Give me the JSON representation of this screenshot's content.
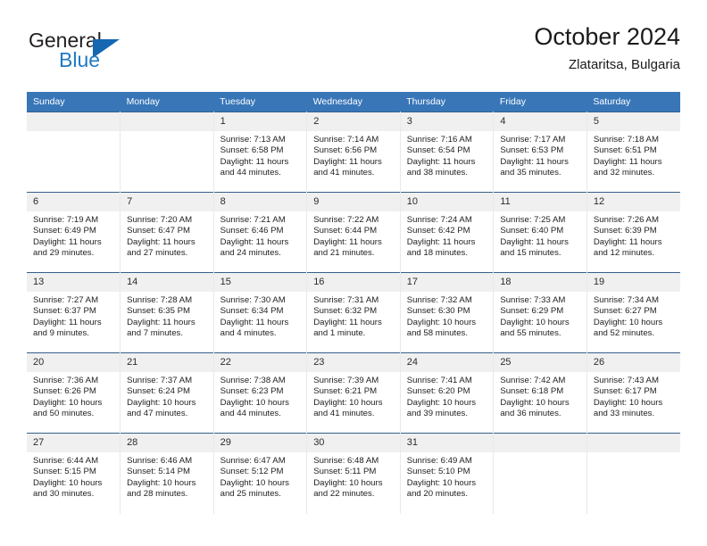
{
  "brand": {
    "name_top": "General",
    "name_bottom": "Blue",
    "accent_color": "#1567b2",
    "blue_text_color": "#1f7ac4"
  },
  "header": {
    "title": "October 2024",
    "subtitle": "Zlataritsa, Bulgaria"
  },
  "calendar": {
    "header_bg": "#3876b8",
    "header_text_color": "#ffffff",
    "daynum_bg": "#f0f0f0",
    "row_rule_color": "#34618c",
    "weekday_headers": [
      "Sunday",
      "Monday",
      "Tuesday",
      "Wednesday",
      "Thursday",
      "Friday",
      "Saturday"
    ],
    "weeks": [
      [
        {
          "date": "",
          "sunrise": "",
          "sunset": "",
          "daylight": "",
          "empty": true
        },
        {
          "date": "",
          "sunrise": "",
          "sunset": "",
          "daylight": "",
          "empty": true
        },
        {
          "date": "1",
          "sunrise": "Sunrise: 7:13 AM",
          "sunset": "Sunset: 6:58 PM",
          "daylight": "Daylight: 11 hours and 44 minutes."
        },
        {
          "date": "2",
          "sunrise": "Sunrise: 7:14 AM",
          "sunset": "Sunset: 6:56 PM",
          "daylight": "Daylight: 11 hours and 41 minutes."
        },
        {
          "date": "3",
          "sunrise": "Sunrise: 7:16 AM",
          "sunset": "Sunset: 6:54 PM",
          "daylight": "Daylight: 11 hours and 38 minutes."
        },
        {
          "date": "4",
          "sunrise": "Sunrise: 7:17 AM",
          "sunset": "Sunset: 6:53 PM",
          "daylight": "Daylight: 11 hours and 35 minutes."
        },
        {
          "date": "5",
          "sunrise": "Sunrise: 7:18 AM",
          "sunset": "Sunset: 6:51 PM",
          "daylight": "Daylight: 11 hours and 32 minutes."
        }
      ],
      [
        {
          "date": "6",
          "sunrise": "Sunrise: 7:19 AM",
          "sunset": "Sunset: 6:49 PM",
          "daylight": "Daylight: 11 hours and 29 minutes."
        },
        {
          "date": "7",
          "sunrise": "Sunrise: 7:20 AM",
          "sunset": "Sunset: 6:47 PM",
          "daylight": "Daylight: 11 hours and 27 minutes."
        },
        {
          "date": "8",
          "sunrise": "Sunrise: 7:21 AM",
          "sunset": "Sunset: 6:46 PM",
          "daylight": "Daylight: 11 hours and 24 minutes."
        },
        {
          "date": "9",
          "sunrise": "Sunrise: 7:22 AM",
          "sunset": "Sunset: 6:44 PM",
          "daylight": "Daylight: 11 hours and 21 minutes."
        },
        {
          "date": "10",
          "sunrise": "Sunrise: 7:24 AM",
          "sunset": "Sunset: 6:42 PM",
          "daylight": "Daylight: 11 hours and 18 minutes."
        },
        {
          "date": "11",
          "sunrise": "Sunrise: 7:25 AM",
          "sunset": "Sunset: 6:40 PM",
          "daylight": "Daylight: 11 hours and 15 minutes."
        },
        {
          "date": "12",
          "sunrise": "Sunrise: 7:26 AM",
          "sunset": "Sunset: 6:39 PM",
          "daylight": "Daylight: 11 hours and 12 minutes."
        }
      ],
      [
        {
          "date": "13",
          "sunrise": "Sunrise: 7:27 AM",
          "sunset": "Sunset: 6:37 PM",
          "daylight": "Daylight: 11 hours and 9 minutes."
        },
        {
          "date": "14",
          "sunrise": "Sunrise: 7:28 AM",
          "sunset": "Sunset: 6:35 PM",
          "daylight": "Daylight: 11 hours and 7 minutes."
        },
        {
          "date": "15",
          "sunrise": "Sunrise: 7:30 AM",
          "sunset": "Sunset: 6:34 PM",
          "daylight": "Daylight: 11 hours and 4 minutes."
        },
        {
          "date": "16",
          "sunrise": "Sunrise: 7:31 AM",
          "sunset": "Sunset: 6:32 PM",
          "daylight": "Daylight: 11 hours and 1 minute."
        },
        {
          "date": "17",
          "sunrise": "Sunrise: 7:32 AM",
          "sunset": "Sunset: 6:30 PM",
          "daylight": "Daylight: 10 hours and 58 minutes."
        },
        {
          "date": "18",
          "sunrise": "Sunrise: 7:33 AM",
          "sunset": "Sunset: 6:29 PM",
          "daylight": "Daylight: 10 hours and 55 minutes."
        },
        {
          "date": "19",
          "sunrise": "Sunrise: 7:34 AM",
          "sunset": "Sunset: 6:27 PM",
          "daylight": "Daylight: 10 hours and 52 minutes."
        }
      ],
      [
        {
          "date": "20",
          "sunrise": "Sunrise: 7:36 AM",
          "sunset": "Sunset: 6:26 PM",
          "daylight": "Daylight: 10 hours and 50 minutes."
        },
        {
          "date": "21",
          "sunrise": "Sunrise: 7:37 AM",
          "sunset": "Sunset: 6:24 PM",
          "daylight": "Daylight: 10 hours and 47 minutes."
        },
        {
          "date": "22",
          "sunrise": "Sunrise: 7:38 AM",
          "sunset": "Sunset: 6:23 PM",
          "daylight": "Daylight: 10 hours and 44 minutes."
        },
        {
          "date": "23",
          "sunrise": "Sunrise: 7:39 AM",
          "sunset": "Sunset: 6:21 PM",
          "daylight": "Daylight: 10 hours and 41 minutes."
        },
        {
          "date": "24",
          "sunrise": "Sunrise: 7:41 AM",
          "sunset": "Sunset: 6:20 PM",
          "daylight": "Daylight: 10 hours and 39 minutes."
        },
        {
          "date": "25",
          "sunrise": "Sunrise: 7:42 AM",
          "sunset": "Sunset: 6:18 PM",
          "daylight": "Daylight: 10 hours and 36 minutes."
        },
        {
          "date": "26",
          "sunrise": "Sunrise: 7:43 AM",
          "sunset": "Sunset: 6:17 PM",
          "daylight": "Daylight: 10 hours and 33 minutes."
        }
      ],
      [
        {
          "date": "27",
          "sunrise": "Sunrise: 6:44 AM",
          "sunset": "Sunset: 5:15 PM",
          "daylight": "Daylight: 10 hours and 30 minutes."
        },
        {
          "date": "28",
          "sunrise": "Sunrise: 6:46 AM",
          "sunset": "Sunset: 5:14 PM",
          "daylight": "Daylight: 10 hours and 28 minutes."
        },
        {
          "date": "29",
          "sunrise": "Sunrise: 6:47 AM",
          "sunset": "Sunset: 5:12 PM",
          "daylight": "Daylight: 10 hours and 25 minutes."
        },
        {
          "date": "30",
          "sunrise": "Sunrise: 6:48 AM",
          "sunset": "Sunset: 5:11 PM",
          "daylight": "Daylight: 10 hours and 22 minutes."
        },
        {
          "date": "31",
          "sunrise": "Sunrise: 6:49 AM",
          "sunset": "Sunset: 5:10 PM",
          "daylight": "Daylight: 10 hours and 20 minutes."
        },
        {
          "date": "",
          "sunrise": "",
          "sunset": "",
          "daylight": "",
          "empty": true
        },
        {
          "date": "",
          "sunrise": "",
          "sunset": "",
          "daylight": "",
          "empty": true
        }
      ]
    ]
  }
}
